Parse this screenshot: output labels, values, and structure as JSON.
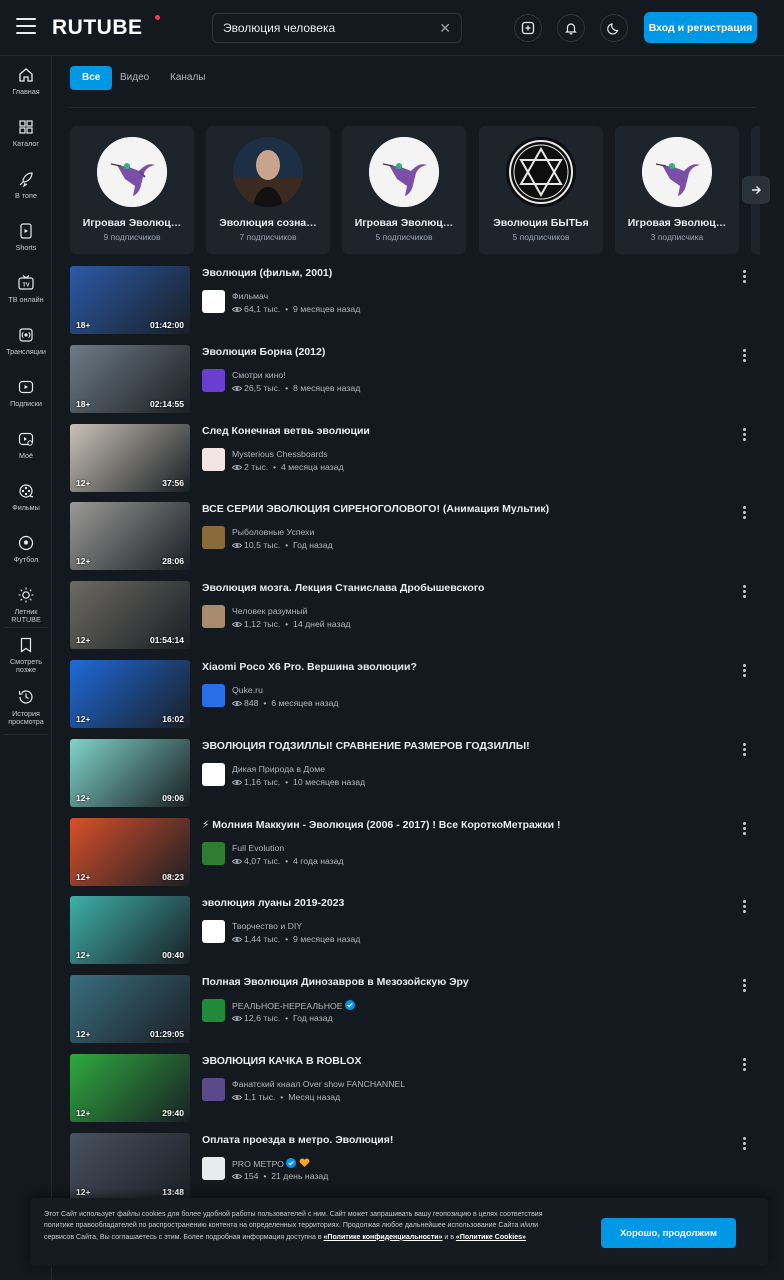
{
  "header": {
    "logo": "RUTUBE",
    "search_value": "Эволюция человека",
    "login_label": "Вход и регистрация"
  },
  "sidebar": {
    "items": [
      {
        "label": "Главная",
        "icon": "home-icon"
      },
      {
        "label": "Каталог",
        "icon": "grid-icon"
      },
      {
        "label": "В топе",
        "icon": "rocket-icon"
      },
      {
        "label": "Shorts",
        "icon": "shorts-icon"
      },
      {
        "label": "ТВ онлайн",
        "icon": "tv-icon"
      },
      {
        "label": "Трансляции",
        "icon": "broadcast-icon"
      },
      {
        "label": "Подписки",
        "icon": "subscriptions-icon"
      },
      {
        "label": "Моё",
        "icon": "my-icon"
      },
      {
        "label": "Фильмы",
        "icon": "film-icon"
      },
      {
        "label": "Футбол",
        "icon": "football-icon"
      },
      {
        "label": "Летник RUTUBE",
        "icon": "sun-icon"
      },
      {
        "label": "Смотреть позже",
        "icon": "bookmark-icon"
      },
      {
        "label": "История просмотра",
        "icon": "history-icon"
      }
    ]
  },
  "tabs": [
    {
      "label": "Все",
      "active": true
    },
    {
      "label": "Видео",
      "active": false
    },
    {
      "label": "Каналы",
      "active": false
    }
  ],
  "channels": [
    {
      "name": "Игровая Эволюц…",
      "subs": "9 подписчиков",
      "avatar": "hummingbird"
    },
    {
      "name": "Эволюция созна…",
      "subs": "7 подписчиков",
      "avatar": "man"
    },
    {
      "name": "Игровая Эволюц…",
      "subs": "5 подписчиков",
      "avatar": "hummingbird"
    },
    {
      "name": "Эволюция БЫТЬя",
      "subs": "5 подписчиков",
      "avatar": "star"
    },
    {
      "name": "Игровая Эволюц…",
      "subs": "3 подписчика",
      "avatar": "hummingbird"
    }
  ],
  "videos": [
    {
      "title": "Эволюция (фильм, 2001)",
      "channel": "Фильмач",
      "views": "64,1 тыс.",
      "date": "9 месяцев назад",
      "age": "18+",
      "duration": "01:42:00",
      "thumb_color": "#2b5aa8",
      "avatar_color": "#ffffff"
    },
    {
      "title": "Эволюция Борна (2012)",
      "channel": "Смотри кино!",
      "views": "26,5 тыс.",
      "date": "8 месяцев назад",
      "age": "18+",
      "duration": "02:14:55",
      "thumb_color": "#6f7b85",
      "avatar_color": "#6a3fd0"
    },
    {
      "title": "След Конечная ветвь эволюции",
      "channel": "Mysterious Chessboards",
      "views": "2 тыс.",
      "date": "4 месяца назад",
      "age": "12+",
      "duration": "37:56",
      "thumb_color": "#c9c2b6",
      "avatar_color": "#f1e6e2"
    },
    {
      "title": "ВСЕ СЕРИИ ЭВОЛЮЦИЯ СИРЕНОГОЛОВОГО! (Анимация Мультик)",
      "channel": "Рыболовные Успехи",
      "views": "10,5 тыс.",
      "date": "Год назад",
      "age": "12+",
      "duration": "28:06",
      "thumb_color": "#9a9a96",
      "avatar_color": "#8a6a3a"
    },
    {
      "title": "Эволюция мозга. Лекция Станислава Дробышевского",
      "channel": "Человек разумный",
      "views": "1,12 тыс.",
      "date": "14 дней назад",
      "age": "12+",
      "duration": "01:54:14",
      "thumb_color": "#6d6a63",
      "avatar_color": "#a88a6c"
    },
    {
      "title": "Xiaomi Poco X6 Pro. Вершина эволюции?",
      "channel": "Quke.ru",
      "views": "848",
      "date": "6 месяцев назад",
      "age": "12+",
      "duration": "16:02",
      "thumb_color": "#1e6ad8",
      "avatar_color": "#2a6fe8"
    },
    {
      "title": "ЭВОЛЮЦИЯ ГОДЗИЛЛЫ! СРАВНЕНИЕ РАЗМЕРОВ ГОДЗИЛЛЫ!",
      "channel": "Дикая Природа в Доме",
      "views": "1,16 тыс.",
      "date": "10 месяцев назад",
      "age": "12+",
      "duration": "09:06",
      "thumb_color": "#7fd3c8",
      "avatar_color": "#ffffff"
    },
    {
      "title": "⚡ Молния Маккуин - Эволюция (2006 - 2017) ! Все КороткоМетражки !",
      "channel": "Full Evolution",
      "views": "4,07 тыс.",
      "date": "4 года назад",
      "age": "12+",
      "duration": "08:23",
      "thumb_color": "#d8502a",
      "avatar_color": "#2e7d32"
    },
    {
      "title": "эволюция луаны 2019-2023",
      "channel": "Творчество и DIY",
      "views": "1,44 тыс.",
      "date": "9 месяцев назад",
      "age": "12+",
      "duration": "00:40",
      "thumb_color": "#3fb0a8",
      "avatar_color": "#ffffff"
    },
    {
      "title": "Полная Эволюция Динозавров в Мезозойскую Эру",
      "channel": "РЕАЛЬНОЕ-НЕРЕАЛЬНОЕ",
      "verified": true,
      "views": "12,6 тыс.",
      "date": "Год назад",
      "age": "12+",
      "duration": "01:29:05",
      "thumb_color": "#3a6f80",
      "avatar_color": "#1f8a3a"
    },
    {
      "title": "ЭВОЛЮЦИЯ КАЧКА В ROBLOX",
      "channel": "Фанатский кнаал Over show FANCHANNEL",
      "views": "1,1 тыс.",
      "date": "Месяц назад",
      "age": "12+",
      "duration": "29:40",
      "thumb_color": "#2faa3f",
      "avatar_color": "#5a4a8a"
    },
    {
      "title": "Оплата проезда в метро. Эволюция!",
      "channel": "PRO МЕТРО",
      "verified": true,
      "heart": true,
      "views": "154",
      "date": "21 день назад",
      "age": "12+",
      "duration": "13:48",
      "thumb_color": "#4a5260",
      "avatar_color": "#e8ecef"
    }
  ],
  "cookie": {
    "text": "Этот Сайт использует файлы cookies для более удобной работы пользователей с ним. Сайт может запрашивать вашу геопозицию в целях соответствия политике правообладателей по распространению контента на определенных территориях. Продолжая любое дальнейшее использование Сайта и/или сервисов Сайта, Вы соглашаетесь с этим. Более подробная информация доступна в ",
    "link1": "«Политике конфиденциальности»",
    "mid": " и в ",
    "link2": "«Политике Cookies»",
    "button": "Хорошо, продолжим"
  }
}
